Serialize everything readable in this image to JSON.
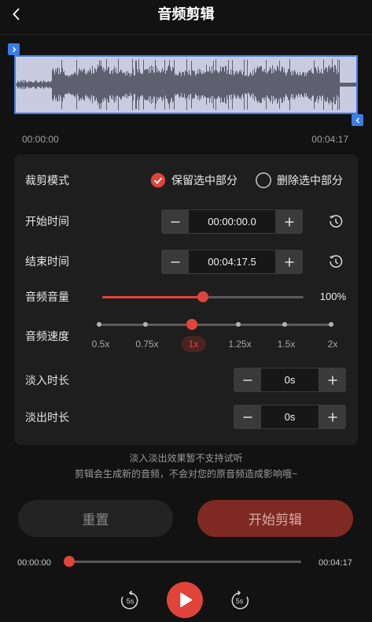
{
  "header": {
    "title": "音频剪辑",
    "back_icon": "chevron-left-icon"
  },
  "colors": {
    "background": "#121212",
    "panel": "#1e1e1e",
    "accent": "#e0443a",
    "selection_border": "#3a7de8",
    "waveform_background": "#c9cbe0",
    "start_button": "#7e2a22"
  },
  "waveform": {
    "start_handle_icon": "chevron-right-icon",
    "end_handle_icon": "chevron-left-icon",
    "selection_start": "00:00:00",
    "selection_end": "00:04:17"
  },
  "settings": {
    "trim_mode": {
      "label": "裁剪模式",
      "options": [
        {
          "label": "保留选中部分",
          "selected": true
        },
        {
          "label": "删除选中部分",
          "selected": false
        }
      ]
    },
    "start_time": {
      "label": "开始时间",
      "value": "00:00:00.0",
      "reset_icon": "clock-reset-icon"
    },
    "end_time": {
      "label": "结束时间",
      "value": "00:04:17.5",
      "reset_icon": "clock-reset-icon"
    },
    "volume": {
      "label": "音频音量",
      "value_text": "100%",
      "fill": 0.5
    },
    "speed": {
      "label": "音频速度",
      "options": [
        "0.5x",
        "0.75x",
        "1x",
        "1.25x",
        "1.5x",
        "2x"
      ],
      "selected_index": 2
    },
    "fade_in": {
      "label": "淡入时长",
      "value": "0s"
    },
    "fade_out": {
      "label": "淡出时长",
      "value": "0s"
    },
    "stepper_icons": {
      "decrement": "minus-icon",
      "increment": "plus-icon"
    }
  },
  "notes": [
    "淡入淡出效果暂不支持试听",
    "剪辑会生成新的音频，不会对您的原音频造成影响哦~"
  ],
  "actions": {
    "reset_label": "重置",
    "start_label": "开始剪辑"
  },
  "player": {
    "current_time": "00:00:00",
    "total_time": "00:04:17",
    "progress": 0,
    "rewind_label": "5s",
    "forward_label": "5s",
    "play_icon": "play-icon"
  }
}
